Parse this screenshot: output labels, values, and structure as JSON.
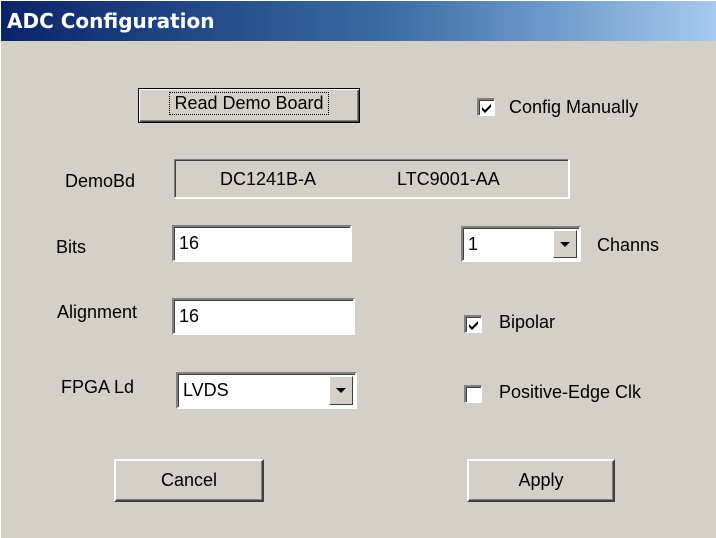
{
  "window": {
    "title": "ADC Configuration"
  },
  "buttons": {
    "read_demo_board": "Read Demo Board",
    "cancel": "Cancel",
    "apply": "Apply"
  },
  "config_manually": {
    "label": "Config Manually",
    "checked": true
  },
  "demobd": {
    "label": "DemoBd",
    "board": "DC1241B-A",
    "part": "LTC9001-AA"
  },
  "bits": {
    "label": "Bits",
    "value": "16"
  },
  "alignment": {
    "label": "Alignment",
    "value": "16"
  },
  "fpga_ld": {
    "label": "FPGA Ld",
    "value": "LVDS"
  },
  "channs": {
    "label": "Channs",
    "value": "1"
  },
  "bipolar": {
    "label": "Bipolar",
    "checked": true
  },
  "positive_edge_clk": {
    "label": "Positive-Edge Clk",
    "checked": false
  },
  "colors": {
    "face": "#d4d0c8",
    "title_start": "#0a246a",
    "title_end": "#a6caf0"
  }
}
